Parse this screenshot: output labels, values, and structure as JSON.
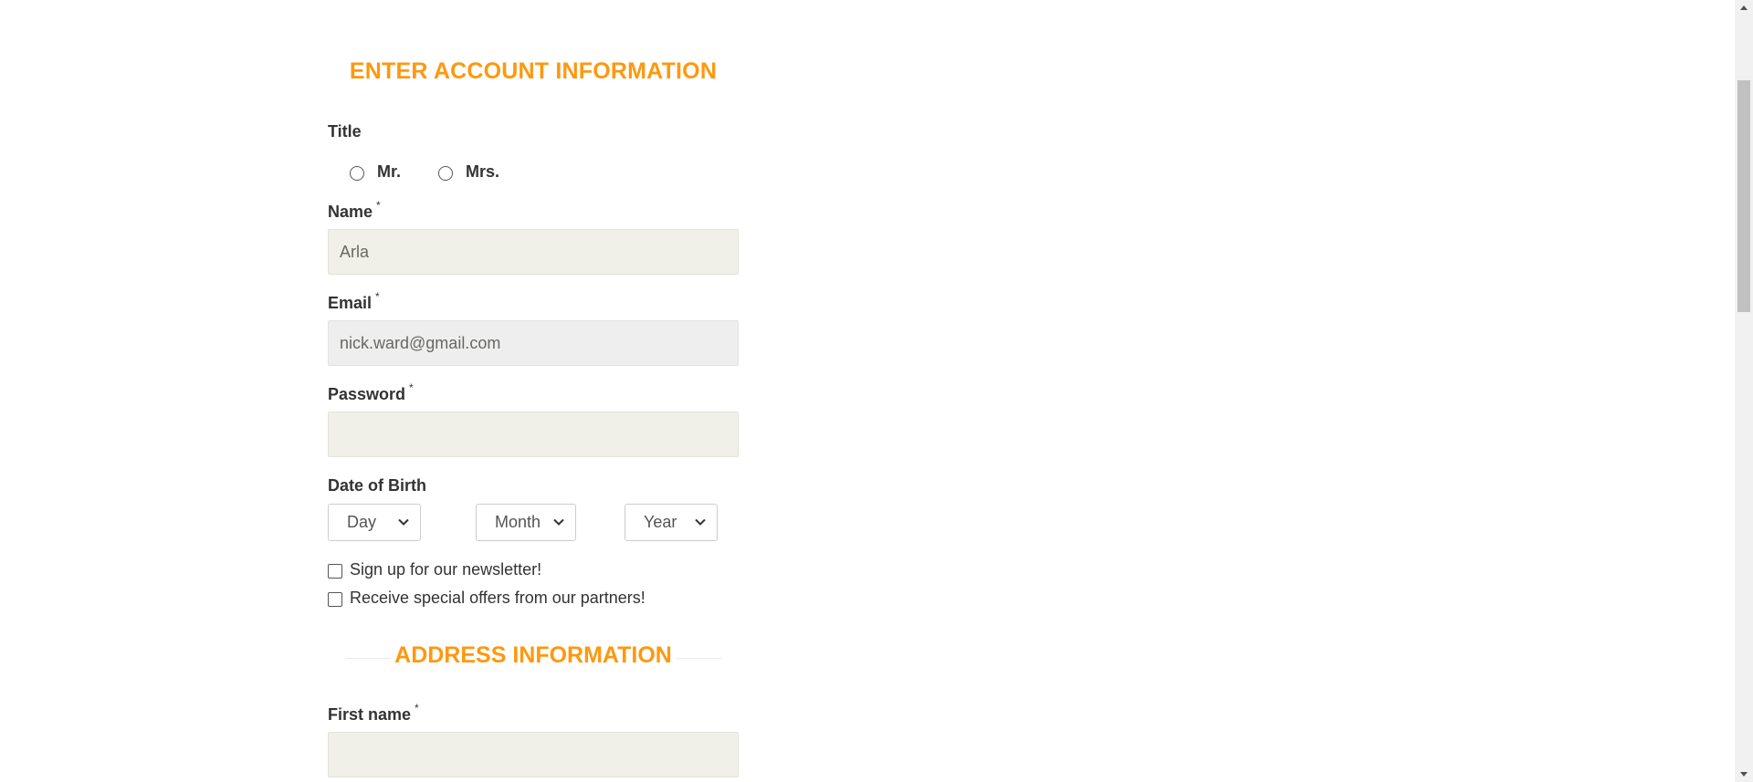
{
  "account": {
    "heading": "ENTER ACCOUNT INFORMATION",
    "title_label": "Title",
    "title_options": [
      "Mr.",
      "Mrs."
    ],
    "name_label": "Name",
    "name_value": "Arla",
    "email_label": "Email",
    "email_value": "nick.ward@gmail.com",
    "password_label": "Password",
    "password_value": "",
    "required_mark": "*",
    "dob_label": "Date of Birth",
    "dob_day": "Day",
    "dob_month": "Month",
    "dob_year": "Year",
    "newsletter_label": "Sign up for our newsletter!",
    "offers_label": "Receive special offers from our partners!"
  },
  "address": {
    "heading": "ADDRESS INFORMATION",
    "first_name_label": "First name",
    "first_name_value": ""
  },
  "colors": {
    "accent": "#fe980f",
    "input_bg": "#f0f0e9",
    "disabled_bg": "#eeeeee"
  },
  "icons": {
    "select_arrow": "chevron-down-icon",
    "scroll_up": "scroll-up-arrow-icon",
    "scroll_down": "scroll-down-arrow-icon"
  }
}
